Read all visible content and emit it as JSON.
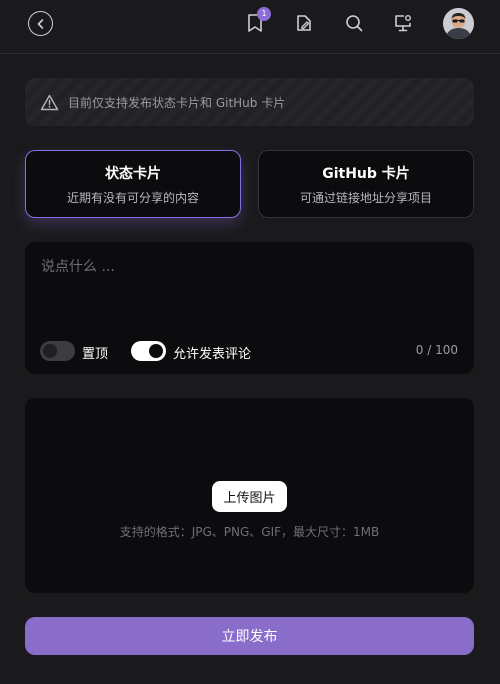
{
  "header": {
    "back_icon": "chevron-left-icon",
    "bookmark_badge": "1",
    "icons": [
      "bookmark-icon",
      "edit-card-icon",
      "search-icon",
      "monitor-settings-icon"
    ]
  },
  "notice": {
    "icon": "warning-triangle-icon",
    "text": "目前仅支持发布状态卡片和 GitHub 卡片"
  },
  "tabs": [
    {
      "title": "状态卡片",
      "subtitle": "近期有没有可分享的内容",
      "active": true
    },
    {
      "title": "GitHub 卡片",
      "subtitle": "可通过链接地址分享项目",
      "active": false
    }
  ],
  "compose": {
    "placeholder": "说点什么 ...",
    "pin_label": "置顶",
    "pin_on": false,
    "allow_comments_label": "允许发表评论",
    "allow_comments_on": true,
    "counter": "0 / 100"
  },
  "upload": {
    "button_label": "上传图片",
    "hint": "支持的格式：JPG、PNG、GIF，最大尺寸：1MB"
  },
  "publish_label": "立即发布",
  "colors": {
    "accent": "#8a6dcb",
    "background": "#1a1a1c",
    "card": "#0c0c0e"
  }
}
